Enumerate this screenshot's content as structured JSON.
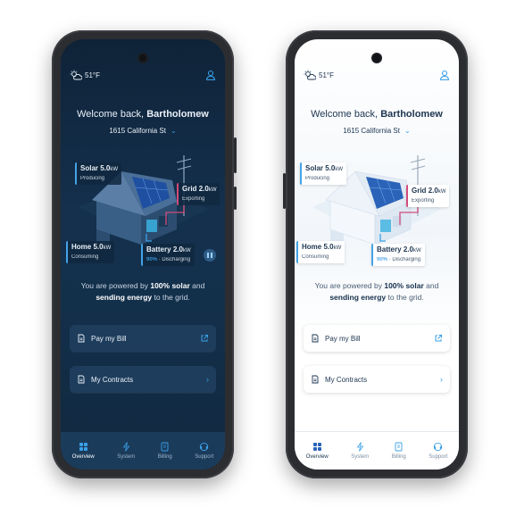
{
  "colors": {
    "accent": "#3aa0e8",
    "grid_accent": "#d24b7b",
    "dark_bg": "#13304b",
    "light_bg": "#ffffff"
  },
  "screens": [
    {
      "theme": "dark",
      "header": {
        "temperature": "51°F",
        "weather_icon": "sun-cloud-icon",
        "profile_icon": "user-icon"
      },
      "welcome": {
        "prefix": "Welcome back, ",
        "name": "Bartholomew"
      },
      "address": {
        "text": "1615 California St",
        "icon": "chevron-down-icon"
      },
      "energy": {
        "solar": {
          "label": "Solar",
          "value": "5.0",
          "unit": "kW",
          "status": "Producing"
        },
        "grid": {
          "label": "Grid",
          "value": "2.0",
          "unit": "kW",
          "status": "Exporting"
        },
        "home": {
          "label": "Home",
          "value": "5.0",
          "unit": "kW",
          "status": "Consuming"
        },
        "battery": {
          "label": "Battery",
          "value": "2.0",
          "unit": "kW",
          "percent": "90%",
          "status": "· Discharging"
        }
      },
      "powered": {
        "pre": "You are powered by ",
        "bold1": "100% solar",
        "mid": " and",
        "bold2": "sending energy",
        "post": " to the grid."
      },
      "cards": {
        "bill": "Pay my Bill",
        "contracts": "My Contracts"
      },
      "nav": {
        "overview": "Overview",
        "system": "System",
        "billing": "Billing",
        "support": "Support"
      }
    },
    {
      "theme": "light",
      "header": {
        "temperature": "51°F",
        "weather_icon": "sun-cloud-icon",
        "profile_icon": "user-icon"
      },
      "welcome": {
        "prefix": "Welcome back, ",
        "name": "Bartholomew"
      },
      "address": {
        "text": "1615 California St",
        "icon": "chevron-down-icon"
      },
      "energy": {
        "solar": {
          "label": "Solar",
          "value": "5.0",
          "unit": "kW",
          "status": "Producing"
        },
        "grid": {
          "label": "Grid",
          "value": "2.0",
          "unit": "kW",
          "status": "Exporting"
        },
        "home": {
          "label": "Home",
          "value": "5.0",
          "unit": "kW",
          "status": "Consuming"
        },
        "battery": {
          "label": "Battery",
          "value": "2.0",
          "unit": "kW",
          "percent": "90%",
          "status": "· Discharging"
        }
      },
      "powered": {
        "pre": "You are powered by ",
        "bold1": "100% solar",
        "mid": " and",
        "bold2": "sending energy",
        "post": " to the grid."
      },
      "cards": {
        "bill": "Pay my Bill",
        "contracts": "My Contracts"
      },
      "nav": {
        "overview": "Overview",
        "system": "System",
        "billing": "Billing",
        "support": "Support"
      }
    }
  ]
}
